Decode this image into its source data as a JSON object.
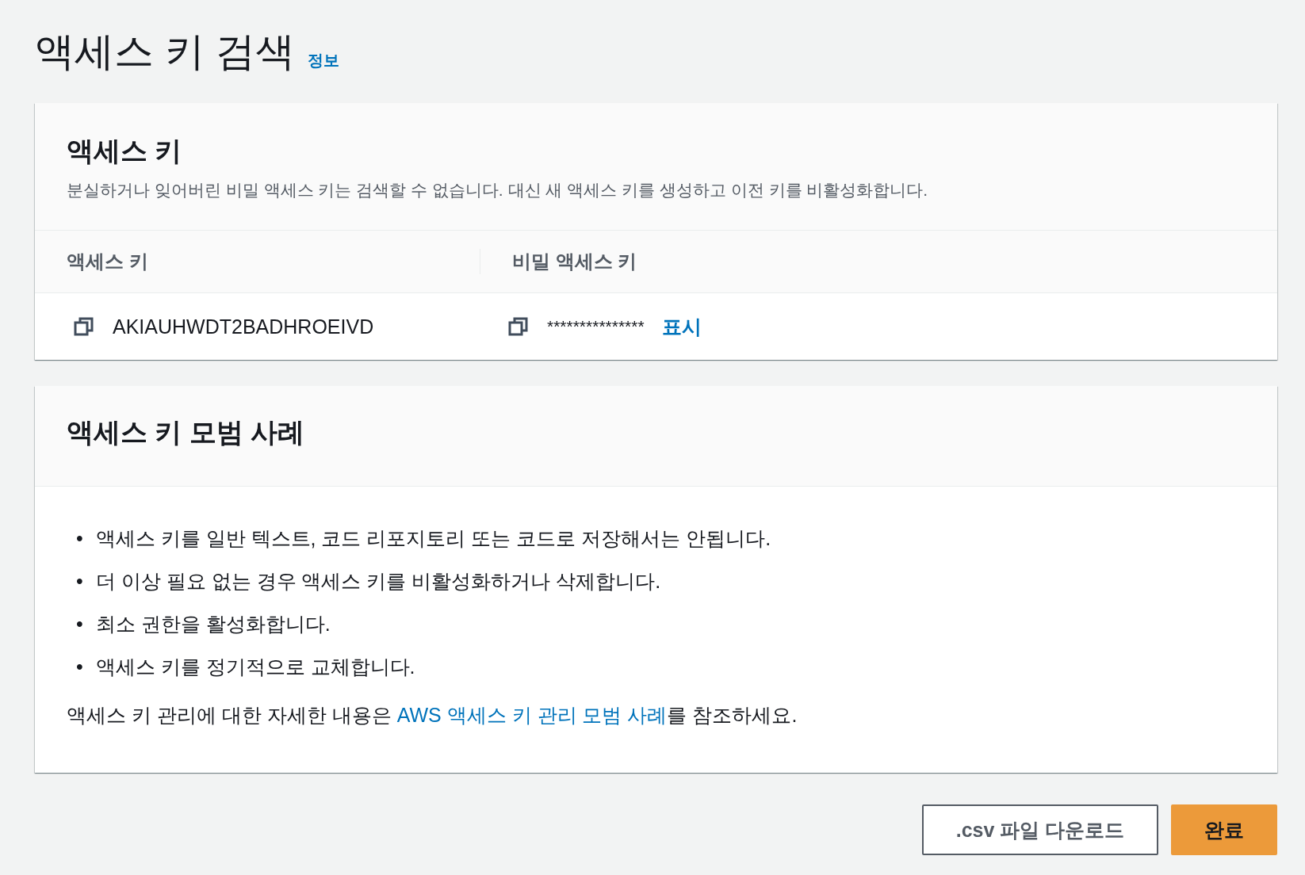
{
  "page": {
    "title": "액세스 키 검색",
    "info_link": "정보"
  },
  "access_key_card": {
    "title": "액세스 키",
    "description": "분실하거나 잊어버린 비밀 액세스 키는 검색할 수 없습니다. 대신 새 액세스 키를 생성하고 이전 키를 비활성화합니다.",
    "columns": [
      "액세스 키",
      "비밀 액세스 키"
    ],
    "access_key": "AKIAUHWDT2BADHROEIVD",
    "secret_key": "***************",
    "show_link": "표시"
  },
  "best_practices": {
    "title": "액세스 키 모범 사례",
    "items": [
      {
        "bullet": "•",
        "text": "액세스 키를 일반 텍스트, 코드 리포지토리 또는 코드로 저장해서는 안됩니다."
      },
      {
        "bullet": "•",
        "text": "더 이상 필요 없는 경우 액세스 키를 비활성화하거나 삭제합니다."
      },
      {
        "bullet": "•",
        "text": "최소 권한을 활성화합니다."
      },
      {
        "bullet": "•",
        "text": "액세스 키를 정기적으로 교체합니다."
      }
    ],
    "footer_before": "액세스 키 관리에 대한 자세한 내용은 ",
    "footer_link": "AWS 액세스 키 관리 모범 사례",
    "footer_after": "를 참조하세요."
  },
  "buttons": [
    {
      "label": ".csv 파일 다운로드",
      "kind": "secondary"
    },
    {
      "label": "완료",
      "kind": "primary"
    }
  ]
}
